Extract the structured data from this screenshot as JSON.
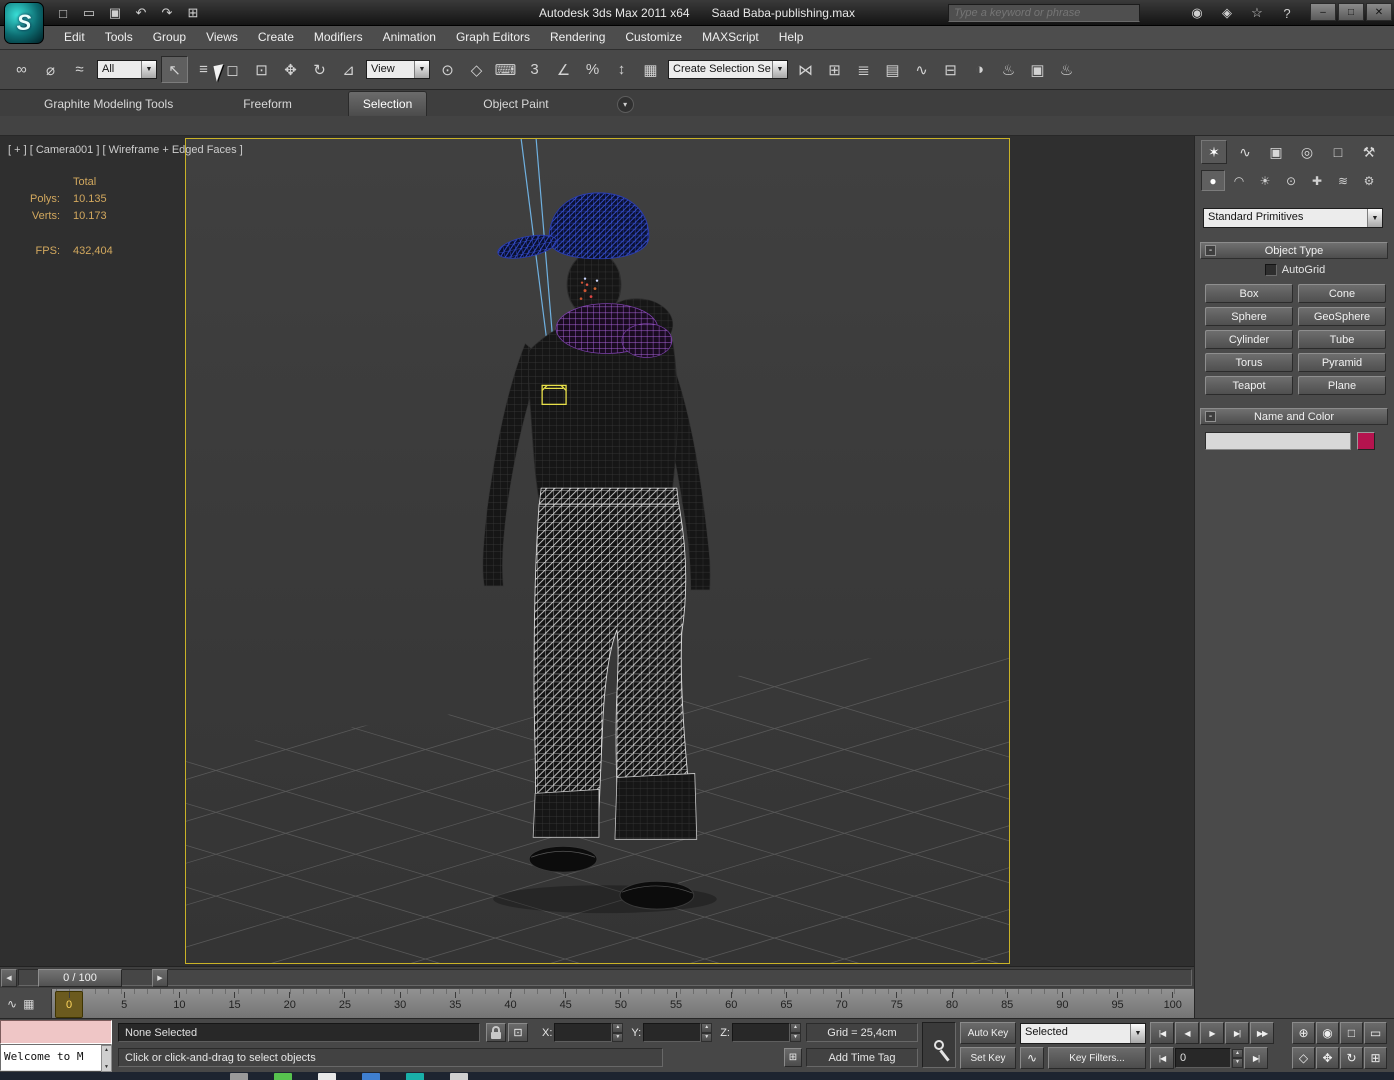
{
  "colors": {
    "viewport_border": "#c9b227",
    "selection_outline": "#e8e04a",
    "name_color_swatch": "#b5134e",
    "cap_wireframe": "#3a55e0",
    "scarf_wireframe": "#a863d8",
    "pants_wireframe": "#dcdcdc",
    "stat_text": "#d2a85e"
  },
  "titlebar": {
    "app_title": "Autodesk 3ds Max 2011 x64",
    "doc_title": "Saad Baba-publishing.max",
    "search_placeholder": "Type a keyword or phrase",
    "logo_letter": "S",
    "quick_access": [
      {
        "name": "new-scene-icon",
        "glyph": "□"
      },
      {
        "name": "open-file-icon",
        "glyph": "▭"
      },
      {
        "name": "save-file-icon",
        "glyph": "▣"
      },
      {
        "name": "undo-icon",
        "glyph": "↶"
      },
      {
        "name": "redo-icon",
        "glyph": "↷"
      },
      {
        "name": "project-toolbar-icon",
        "glyph": "⊞"
      }
    ],
    "infocenter": [
      {
        "name": "infocenter-search-icon",
        "glyph": "◉"
      },
      {
        "name": "communication-center-icon",
        "glyph": "◈"
      },
      {
        "name": "favorites-icon",
        "glyph": "☆"
      },
      {
        "name": "help-icon",
        "glyph": "?"
      }
    ],
    "window_controls": [
      {
        "name": "minimize-button",
        "glyph": "–"
      },
      {
        "name": "restore-button",
        "glyph": "□"
      },
      {
        "name": "close-button",
        "glyph": "✕"
      }
    ]
  },
  "menubar": {
    "items": [
      "Edit",
      "Tools",
      "Group",
      "Views",
      "Create",
      "Modifiers",
      "Animation",
      "Graph Editors",
      "Rendering",
      "Customize",
      "MAXScript",
      "Help"
    ]
  },
  "toolbar": {
    "group1": [
      {
        "name": "select-and-link-icon",
        "glyph": "∞",
        "cls": "ticon"
      },
      {
        "name": "unlink-selection-icon",
        "glyph": "⌀",
        "cls": "ticon"
      },
      {
        "name": "bind-to-space-warp-icon",
        "glyph": "≈",
        "cls": "ticon"
      }
    ],
    "selection_filter_value": "All",
    "group2": [
      {
        "name": "select-object-icon",
        "glyph": "↖",
        "cls": "ticon pressed"
      },
      {
        "name": "select-by-name-icon",
        "glyph": "≡",
        "cls": "ticon"
      },
      {
        "name": "rectangular-selection-region-icon",
        "glyph": "◻",
        "cls": "ticon"
      },
      {
        "name": "window-crossing-icon",
        "glyph": "⊡",
        "cls": "ticon"
      },
      {
        "name": "select-and-move-icon",
        "glyph": "✥",
        "cls": "ticon"
      },
      {
        "name": "select-and-rotate-icon",
        "glyph": "↻",
        "cls": "ticon"
      },
      {
        "name": "select-and-scale-icon",
        "glyph": "⊿",
        "cls": "ticon"
      }
    ],
    "reference_coordinate_value": "View",
    "group3": [
      {
        "name": "use-pivot-point-icon",
        "glyph": "⊙",
        "cls": "ticon"
      },
      {
        "name": "select-and-manipulate-icon",
        "glyph": "◇",
        "cls": "ticon"
      },
      {
        "name": "keyboard-override-icon",
        "glyph": "⌨",
        "cls": "ticon"
      },
      {
        "name": "snaps-toggle-icon",
        "glyph": "3",
        "cls": "ticon"
      },
      {
        "name": "angle-snap-icon",
        "glyph": "∠",
        "cls": "ticon"
      },
      {
        "name": "percent-snap-icon",
        "glyph": "%",
        "cls": "ticon"
      },
      {
        "name": "spinner-snap-icon",
        "glyph": "↕",
        "cls": "ticon"
      },
      {
        "name": "edit-named-selections-icon",
        "glyph": "▦",
        "cls": "ticon"
      }
    ],
    "named_selection_value": "Create Selection Se",
    "group4": [
      {
        "name": "mirror-icon",
        "glyph": "⋈",
        "cls": "ticon"
      },
      {
        "name": "align-icon",
        "glyph": "⊞",
        "cls": "ticon"
      },
      {
        "name": "layer-manager-icon",
        "glyph": "≣",
        "cls": "ticon"
      },
      {
        "name": "graphite-ribbon-toggle-icon",
        "glyph": "▤",
        "cls": "ticon"
      },
      {
        "name": "curve-editor-icon",
        "glyph": "∿",
        "cls": "ticon"
      },
      {
        "name": "schematic-view-icon",
        "glyph": "⊟",
        "cls": "ticon"
      },
      {
        "name": "material-editor-icon",
        "glyph": "◑",
        "cls": "ticon"
      },
      {
        "name": "render-setup-icon",
        "glyph": "♨",
        "cls": "ticon"
      },
      {
        "name": "rendered-frame-icon",
        "glyph": "▣",
        "cls": "ticon"
      },
      {
        "name": "render-production-icon",
        "glyph": "♨",
        "cls": "ticon"
      }
    ]
  },
  "ribbon": {
    "tabs": [
      {
        "label": "Graphite Modeling Tools",
        "cls": "rtab"
      },
      {
        "label": "Freeform",
        "cls": "rtab"
      },
      {
        "label": "Selection",
        "cls": "rtab active"
      },
      {
        "label": "Object Paint",
        "cls": "rtab"
      }
    ],
    "collapse_glyph": "▾"
  },
  "viewport": {
    "label": "[ + ] [ Camera001 ] [ Wireframe + Edged Faces ]",
    "stats": {
      "total": "Total",
      "polys_label": "Polys:",
      "polys": "10.135",
      "verts_label": "Verts:",
      "verts": "10.173",
      "fps_label": "FPS:",
      "fps": "432,404"
    }
  },
  "command_panel": {
    "tabs": [
      {
        "name": "create-tab",
        "glyph": "✶",
        "cls": "cptab active"
      },
      {
        "name": "modify-tab",
        "glyph": "∿",
        "cls": "cptab"
      },
      {
        "name": "hierarchy-tab",
        "glyph": "▣",
        "cls": "cptab"
      },
      {
        "name": "motion-tab",
        "glyph": "◎",
        "cls": "cptab"
      },
      {
        "name": "display-tab",
        "glyph": "□",
        "cls": "cptab"
      },
      {
        "name": "utilities-tab",
        "glyph": "⚒",
        "cls": "cptab"
      }
    ],
    "subtabs": [
      {
        "name": "geometry-category-icon",
        "glyph": "●",
        "cls": "cpsub active"
      },
      {
        "name": "shapes-category-icon",
        "glyph": "◠",
        "cls": "cpsub"
      },
      {
        "name": "lights-category-icon",
        "glyph": "☀",
        "cls": "cpsub"
      },
      {
        "name": "cameras-category-icon",
        "glyph": "⊙",
        "cls": "cpsub"
      },
      {
        "name": "helpers-category-icon",
        "glyph": "✚",
        "cls": "cpsub"
      },
      {
        "name": "space-warps-category-icon",
        "glyph": "≋",
        "cls": "cpsub"
      },
      {
        "name": "systems-category-icon",
        "glyph": "⚙",
        "cls": "cpsub"
      }
    ],
    "category_dropdown": "Standard Primitives",
    "object_type": {
      "title": "Object Type",
      "collapse": "-",
      "autogrid": "AutoGrid",
      "buttons": [
        {
          "label": "Box"
        },
        {
          "label": "Cone"
        },
        {
          "label": "Sphere"
        },
        {
          "label": "GeoSphere"
        },
        {
          "label": "Cylinder"
        },
        {
          "label": "Tube"
        },
        {
          "label": "Torus"
        },
        {
          "label": "Pyramid"
        },
        {
          "label": "Teapot"
        },
        {
          "label": "Plane"
        }
      ]
    },
    "name_color": {
      "title": "Name and Color",
      "collapse": "-",
      "swatch_color": "#b5134e"
    }
  },
  "timeline": {
    "slider_value": "0 / 100",
    "prev_glyph": "◀",
    "next_glyph": "▶",
    "mini_curve_glyph": "∿",
    "trackbar_filter_glyph": "▦",
    "ticks": [
      {
        "label": "0",
        "cls": "tick current"
      },
      {
        "label": "5",
        "cls": "tick"
      },
      {
        "label": "10",
        "cls": "tick"
      },
      {
        "label": "15",
        "cls": "tick"
      },
      {
        "label": "20",
        "cls": "tick"
      },
      {
        "label": "25",
        "cls": "tick"
      },
      {
        "label": "30",
        "cls": "tick"
      },
      {
        "label": "35",
        "cls": "tick"
      },
      {
        "label": "40",
        "cls": "tick"
      },
      {
        "label": "45",
        "cls": "tick"
      },
      {
        "label": "50",
        "cls": "tick"
      },
      {
        "label": "55",
        "cls": "tick"
      },
      {
        "label": "60",
        "cls": "tick"
      },
      {
        "label": "65",
        "cls": "tick"
      },
      {
        "label": "70",
        "cls": "tick"
      },
      {
        "label": "75",
        "cls": "tick"
      },
      {
        "label": "80",
        "cls": "tick"
      },
      {
        "label": "85",
        "cls": "tick"
      },
      {
        "label": "90",
        "cls": "tick"
      },
      {
        "label": "95",
        "cls": "tick"
      },
      {
        "label": "100",
        "cls": "tick"
      }
    ]
  },
  "statusbar": {
    "listener_text": "Welcome to M",
    "selection_status": "None Selected",
    "x_label": "X:",
    "y_label": "Y:",
    "z_label": "Z:",
    "grid_label": "Grid = 25,4cm",
    "prompt": "Click or click-and-drag to select objects",
    "add_time_tag": "Add Time Tag",
    "auto_key_label": "Auto Key",
    "set_key_label": "Set Key",
    "key_mode_value": "Selected",
    "key_filters_label": "Key Filters...",
    "frame_value": "0",
    "abs_offset_glyph": "⊡",
    "time_tag_glyph": "⊞",
    "key_filter_glyph": "∿",
    "transport_row1": [
      {
        "name": "go-to-start-button",
        "glyph": "|◀"
      },
      {
        "name": "previous-frame-button",
        "glyph": "◀"
      },
      {
        "name": "play-animation-button",
        "glyph": "▶"
      },
      {
        "name": "next-frame-button",
        "glyph": "▶|"
      },
      {
        "name": "go-to-end-button",
        "glyph": "▶▶"
      }
    ],
    "transport_row2_prev": {
      "name": "previous-key-button",
      "glyph": "|◀"
    },
    "transport_row2_next": {
      "name": "next-key-button",
      "glyph": "▶|"
    },
    "nav_row1": [
      {
        "name": "zoom-icon",
        "glyph": "⊕"
      },
      {
        "name": "zoom-all-icon",
        "glyph": "◉"
      },
      {
        "name": "zoom-extents-icon",
        "glyph": "□"
      },
      {
        "name": "zoom-region-icon",
        "glyph": "▭"
      }
    ],
    "nav_row2": [
      {
        "name": "field-of-view-icon",
        "glyph": "◇"
      },
      {
        "name": "pan-icon",
        "glyph": "✥"
      },
      {
        "name": "orbit-icon",
        "glyph": "↻"
      },
      {
        "name": "maximize-viewport-icon",
        "glyph": "⊞"
      }
    ]
  },
  "taskbar": {
    "items": [
      {
        "name": "taskbar-item",
        "color": "#9a9a9a"
      },
      {
        "name": "taskbar-item",
        "color": "#57c24e"
      },
      {
        "name": "taskbar-item",
        "color": "#e8e8e8"
      },
      {
        "name": "taskbar-item",
        "color": "#3f7fd0"
      },
      {
        "name": "taskbar-item",
        "color": "#19b0a8"
      },
      {
        "name": "taskbar-item",
        "color": "#d0d0d0"
      }
    ]
  }
}
